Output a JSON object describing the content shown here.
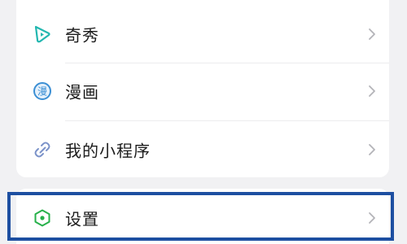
{
  "menu": {
    "items": [
      {
        "label": "奇秀",
        "icon": "qixiu-play-icon",
        "color": "#23b7b0"
      },
      {
        "label": "漫画",
        "icon": "manhua-comic-icon",
        "color": "#3b8fd4"
      },
      {
        "label": "我的小程序",
        "icon": "mini-program-link-icon",
        "color": "#7c93c9"
      }
    ]
  },
  "settings": {
    "label": "设置",
    "icon": "settings-hexagon-icon",
    "color": "#27b04a",
    "highlight_color": "#1d4fa1"
  },
  "chevron_color": "#b3b3b8"
}
